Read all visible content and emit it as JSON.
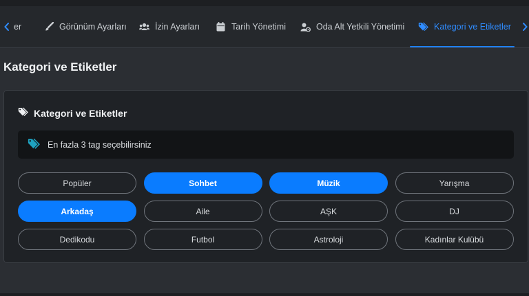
{
  "colors": {
    "accent": "#0a7cff",
    "active_tab_text": "#2f8cff",
    "info_icon": "#1fa2c0"
  },
  "tabs": [
    {
      "label": "er",
      "icon": "partial-icon",
      "active": false
    },
    {
      "label": "Görünüm Ayarları",
      "icon": "brush-icon",
      "active": false
    },
    {
      "label": "İzin Ayarları",
      "icon": "users-icon",
      "active": false
    },
    {
      "label": "Tarih Yönetimi",
      "icon": "calendar-icon",
      "active": false
    },
    {
      "label": "Oda Alt Yetkili Yönetimi",
      "icon": "user-gear-icon",
      "active": false
    },
    {
      "label": "Kategori ve Etiketler",
      "icon": "tags-icon",
      "active": true
    }
  ],
  "page": {
    "title": "Kategori ve Etiketler"
  },
  "card": {
    "title": "Kategori ve Etiketler",
    "info_text": "En fazla 3 tag seçebilirsiniz"
  },
  "tags": [
    {
      "label": "Popüler",
      "selected": false
    },
    {
      "label": "Sohbet",
      "selected": true
    },
    {
      "label": "Müzik",
      "selected": true
    },
    {
      "label": "Yarışma",
      "selected": false
    },
    {
      "label": "Arkadaş",
      "selected": true
    },
    {
      "label": "Aile",
      "selected": false
    },
    {
      "label": "AŞK",
      "selected": false
    },
    {
      "label": "DJ",
      "selected": false
    },
    {
      "label": "Dedikodu",
      "selected": false
    },
    {
      "label": "Futbol",
      "selected": false
    },
    {
      "label": "Astroloji",
      "selected": false
    },
    {
      "label": "Kadınlar Kulübü",
      "selected": false
    }
  ]
}
